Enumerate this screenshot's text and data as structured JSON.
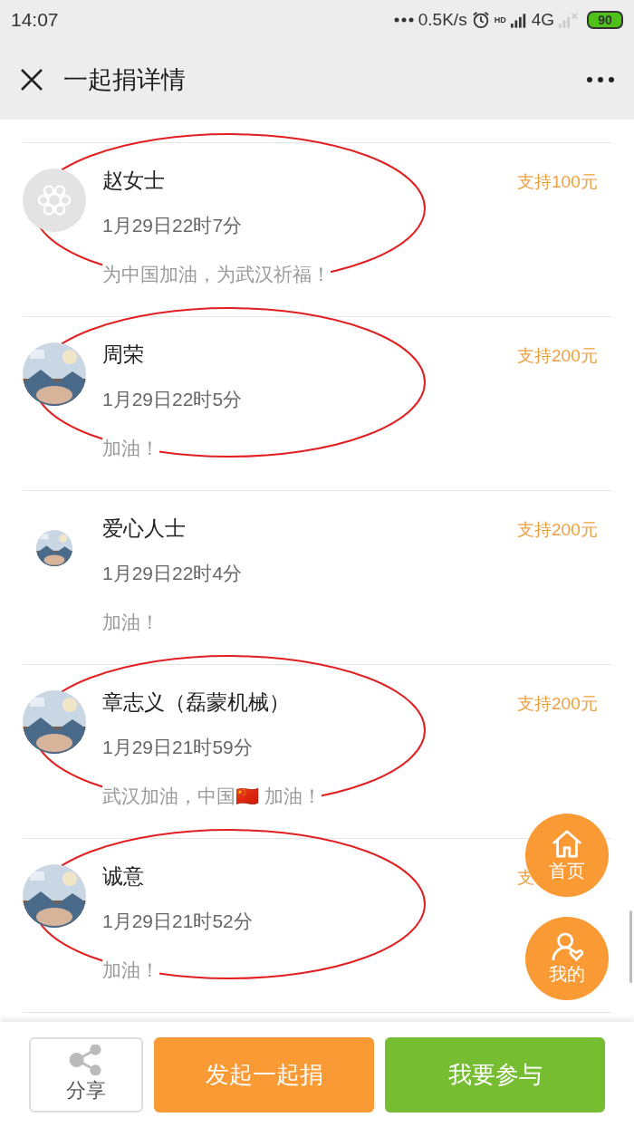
{
  "status_bar": {
    "time": "14:07",
    "speed": "0.5K/s",
    "hd": "HD",
    "network": "4G",
    "battery": "90"
  },
  "header": {
    "title": "一起捐详情"
  },
  "donations": [
    {
      "name": "赵女士",
      "time": "1月29日22时7分",
      "message": "为中国加油，为武汉祈福！",
      "amount": "支持100元",
      "avatar": {
        "kind": "logo"
      },
      "circled": true
    },
    {
      "name": "周荣",
      "time": "1月29日22时5分",
      "message": "加油！",
      "amount": "支持200元",
      "circled": true
    },
    {
      "name": "爱心人士",
      "time": "1月29日22时4分",
      "message": "加油！",
      "amount": "支持200元",
      "avatar": {
        "kind": "small-picture"
      },
      "circled": false
    },
    {
      "name": "章志义（磊蒙机械）",
      "time": "1月29日21时59分",
      "message": "武汉加油，中国🇨🇳 加油！",
      "amount": "支持200元",
      "circled": true
    },
    {
      "name": "诚意",
      "time": "1月29日21时52分",
      "message": "加油！",
      "amount": "支",
      "circled": true
    }
  ],
  "float_buttons": [
    {
      "label": "首页",
      "kind": "home"
    },
    {
      "label": "我的",
      "kind": "profile"
    }
  ],
  "bottom_bar": {
    "share": "分享",
    "start": "发起一起捐",
    "join": "我要参与"
  }
}
